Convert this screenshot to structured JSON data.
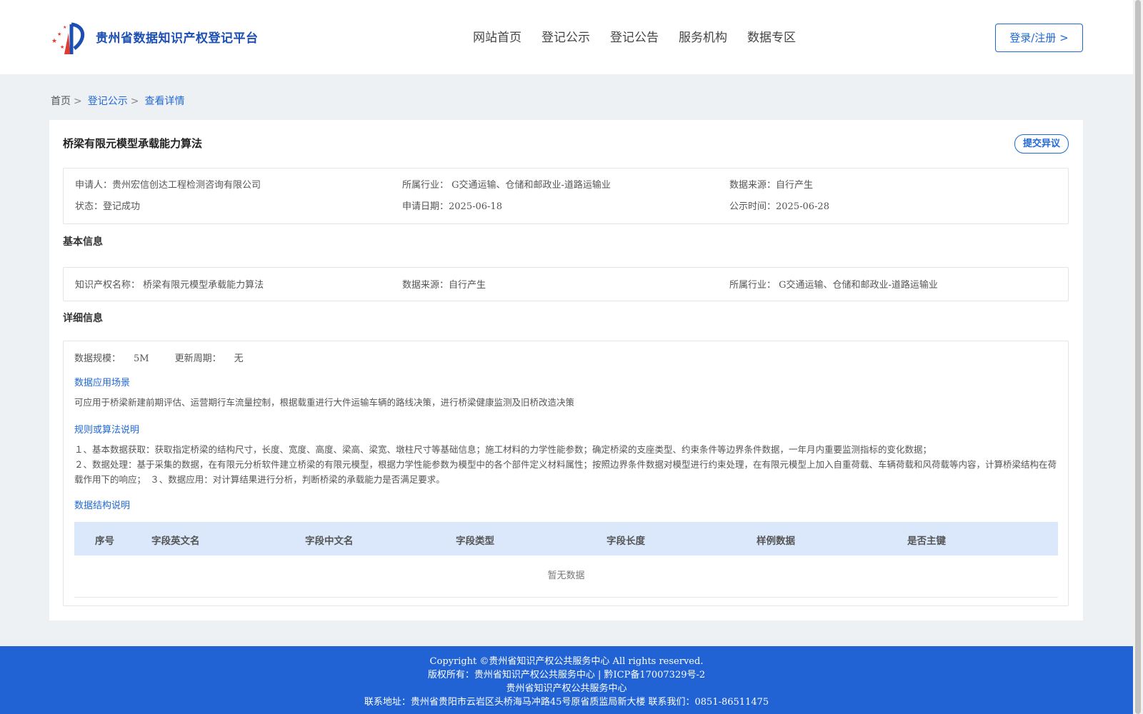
{
  "header": {
    "site_title": "贵州省数据知识产权登记平台",
    "nav": [
      "网站首页",
      "登记公示",
      "登记公告",
      "服务机构",
      "数据专区"
    ],
    "login_label": "登录/注册 >"
  },
  "breadcrumb": {
    "home": "首页",
    "list": "登记公示",
    "current": "查看详情",
    "sep": ">"
  },
  "record": {
    "title": "桥梁有限元模型承载能力算法",
    "objection_label": "提交异议",
    "summary": {
      "applicant_label": "申请人：",
      "applicant": "贵州宏信创达工程检测咨询有限公司",
      "industry_label": "所属行业：",
      "industry": "G交通运输、仓储和邮政业-道路运输业",
      "source_label": "数据来源：",
      "source": "自行产生",
      "status_label": "状态：",
      "status": "登记成功",
      "apply_date_label": "申请日期：",
      "apply_date": "2025-06-18",
      "publish_date_label": "公示时间：",
      "publish_date": "2025-06-28"
    },
    "basic": {
      "heading": "基本信息",
      "ip_name_label": "知识产权名称：",
      "ip_name": "桥梁有限元模型承载能力算法",
      "source_label": "数据来源：",
      "source": "自行产生",
      "industry_label": "所属行业：",
      "industry": "G交通运输、仓储和邮政业-道路运输业"
    },
    "detail": {
      "heading": "详细信息",
      "scale_label": "数据规模：",
      "scale": "5M",
      "update_label": "更新周期：",
      "update": "无",
      "scenario_heading": "数据应用场景",
      "scenario_text": "可应用于桥梁新建前期评估、运营期行车流量控制，根据载重进行大件运输车辆的路线决策，进行桥梁健康监测及旧桥改造决策",
      "algorithm_heading": "规则或算法说明",
      "algorithm_line1": "１、基本数据获取：获取指定桥梁的结构尺寸，长度、宽度、高度、梁高、梁宽、墩柱尺寸等基础信息；施工材料的力学性能参数；确定桥梁的支座类型、约束条件等边界条件数据，一年月内重要监测指标的变化数据；",
      "algorithm_line2": "２、数据处理：基于采集的数据，在有限元分析软件建立桥梁的有限元模型，根据力学性能参数为模型中的各个部件定义材料属性；按照边界条件数据对模型进行约束处理，在有限元模型上加入自重荷载、车辆荷载和风荷载等内容，计算桥梁结构在荷载作用下的响应；　３、数据应用：对计算结果进行分析，判断桥梁的承载能力是否满足要求。",
      "structure_heading": "数据结构说明",
      "columns": [
        "序号",
        "字段英文名",
        "字段中文名",
        "字段类型",
        "字段长度",
        "样例数据",
        "是否主键"
      ],
      "empty_text": "暂无数据"
    }
  },
  "footer": {
    "line1": "Copyright ©贵州省知识产权公共服务中心 All rights reserved.",
    "line2": "版权所有：贵州省知识产权公共服务中心 | 黔ICP备17007329号-2",
    "line3": "贵州省知识产权公共服务中心",
    "line4": "联系地址：贵州省贵阳市云岩区头桥海马冲路45号原省质监局新大楼 联系我们：0851-86511475"
  },
  "colors": {
    "primary": "#1f68d6",
    "footer_bg": "#2163d4",
    "page_bg": "#eef1f4",
    "table_head_bg": "#dbe8fb"
  }
}
